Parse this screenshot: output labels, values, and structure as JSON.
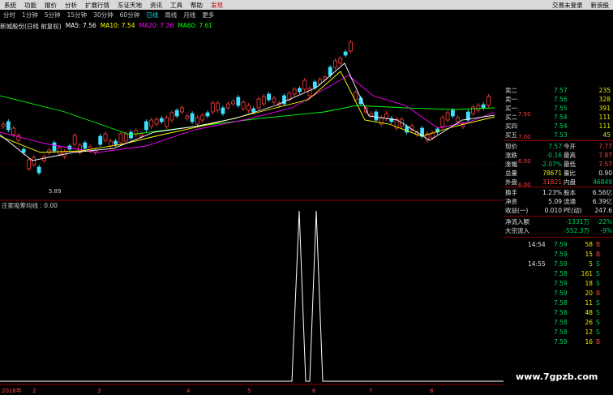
{
  "menu": {
    "items": [
      "系统",
      "功能",
      "报价",
      "分析",
      "扩展行情",
      "东证天地",
      "资讯",
      "工具",
      "帮助"
    ],
    "active": "发现",
    "right": [
      "交易未登录",
      "新浪股"
    ]
  },
  "periods": {
    "items": [
      "分时",
      "1分钟",
      "5分钟",
      "15分钟",
      "30分钟",
      "60分钟",
      "日线",
      "周线",
      "月线",
      "更多"
    ],
    "active": "日线"
  },
  "legend": {
    "stock": "新城股份(日线 前复权)",
    "ma5": "MA5: 7.56",
    "ma10": "MA10: 7.54",
    "ma20": "MA20: 7.26",
    "ma60": "MA60: 7.61",
    "colors": {
      "ma5": "#ffffff",
      "ma10": "#ffff00",
      "ma20": "#ff00ff",
      "ma60": "#00ff00"
    }
  },
  "price_axis": [
    "7.50",
    "7.00",
    "6.50",
    "6.00"
  ],
  "low_label": "5.89",
  "indicator": {
    "label": "庄家吸筹均线 : 0.00"
  },
  "date_axis": [
    "2018年",
    "2",
    "3",
    "4",
    "5",
    "6",
    "7",
    "8"
  ],
  "orderbook": [
    {
      "name": "卖二",
      "price": "7.57",
      "vol": "235"
    },
    {
      "name": "卖一",
      "price": "7.56",
      "vol": "328"
    },
    {
      "name": "买一",
      "price": "7.55",
      "vol": "391"
    },
    {
      "name": "买二",
      "price": "7.54",
      "vol": "111"
    },
    {
      "name": "买四",
      "price": "7.54",
      "vol": "111"
    },
    {
      "name": "买五",
      "price": "7.53",
      "vol": "45"
    }
  ],
  "quote": [
    {
      "l": "现价",
      "v": "7.57",
      "l2": "今开",
      "v2": "7.77"
    },
    {
      "l": "涨跌",
      "v": "-0.16",
      "l2": "最高",
      "v2": "7.87"
    },
    {
      "l": "涨幅",
      "v": "-2.07%",
      "l2": "最低",
      "v2": "7.57"
    },
    {
      "l": "总量",
      "v": "78671",
      "l2": "量比",
      "v2": "0.90"
    },
    {
      "l": "外盘",
      "v": "31821",
      "l2": "内盘",
      "v2": "46849"
    },
    {
      "l": "换手",
      "v": "1.23%",
      "l2": "股本",
      "v2": "6.56亿"
    },
    {
      "l": "净资",
      "v": "5.09",
      "l2": "流通",
      "v2": "6.39亿"
    },
    {
      "l": "收益(一)",
      "v": "0.010",
      "l2": "PE(动)",
      "v2": "247.6"
    }
  ],
  "flow": [
    {
      "l": "净流入额",
      "v": "-1331万",
      "p": "-22%"
    },
    {
      "l": "大宗流入",
      "v": "-552.3万",
      "p": "-9%"
    }
  ],
  "ticks": [
    {
      "t": "14:54",
      "p": "7.59",
      "v": "58",
      "d": "B"
    },
    {
      "t": "",
      "p": "7.59",
      "v": "15",
      "d": "B"
    },
    {
      "t": "14:55",
      "p": "7.59",
      "v": "5",
      "d": "S"
    },
    {
      "t": "",
      "p": "7.58",
      "v": "161",
      "d": "S"
    },
    {
      "t": "",
      "p": "7.59",
      "v": "18",
      "d": "S"
    },
    {
      "t": "",
      "p": "7.59",
      "v": "20",
      "d": "B"
    },
    {
      "t": "",
      "p": "7.58",
      "v": "11",
      "d": "S"
    },
    {
      "t": "",
      "p": "7.58",
      "v": "48",
      "d": "S"
    },
    {
      "t": "",
      "p": "7.58",
      "v": "26",
      "d": "S"
    },
    {
      "t": "",
      "p": "7.58",
      "v": "12",
      "d": "S"
    },
    {
      "t": "",
      "p": "7.59",
      "v": "16",
      "d": "B"
    }
  ],
  "watermark": "www.7gpzb.com"
}
